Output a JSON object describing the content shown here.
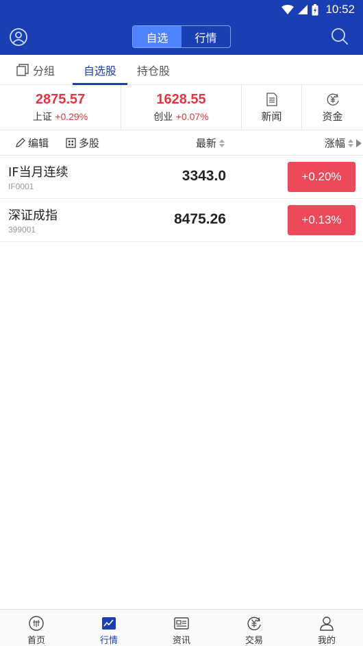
{
  "status": {
    "time": "10:52"
  },
  "header": {
    "segments": [
      {
        "label": "自选",
        "active": true
      },
      {
        "label": "行情",
        "active": false
      }
    ],
    "left_icon": "user-icon",
    "right_icon": "search-icon"
  },
  "subtabs": [
    {
      "label": "分组",
      "icon": "group-icon"
    },
    {
      "label": "自选股",
      "active": true
    },
    {
      "label": "持仓股"
    }
  ],
  "indices": [
    {
      "value": "2875.57",
      "name": "上证",
      "change": "+0.29%"
    },
    {
      "value": "1628.55",
      "name": "创业",
      "change": "+0.07%"
    }
  ],
  "quick_links": [
    {
      "label": "新闻",
      "icon": "news-icon"
    },
    {
      "label": "资金",
      "icon": "yuan-icon"
    }
  ],
  "columns": {
    "edit": "编辑",
    "multi": "多股",
    "latest": "最新",
    "change": "涨幅"
  },
  "rows": [
    {
      "name": "IF当月连续",
      "code": "IF0001",
      "price": "3343.0",
      "change": "+0.20%"
    },
    {
      "name": "深证成指",
      "code": "399001",
      "price": "8475.26",
      "change": "+0.13%"
    }
  ],
  "nav": [
    {
      "label": "首页",
      "icon": "home-icon"
    },
    {
      "label": "行情",
      "icon": "market-chart-icon",
      "active": true
    },
    {
      "label": "资讯",
      "icon": "info-icon"
    },
    {
      "label": "交易",
      "icon": "trade-icon"
    },
    {
      "label": "我的",
      "icon": "profile-icon"
    }
  ],
  "colors": {
    "brand": "#1a3fb3",
    "segment_active": "#4f82ff",
    "up_red": "#e8353f",
    "badge_red": "#ec4a5a"
  }
}
